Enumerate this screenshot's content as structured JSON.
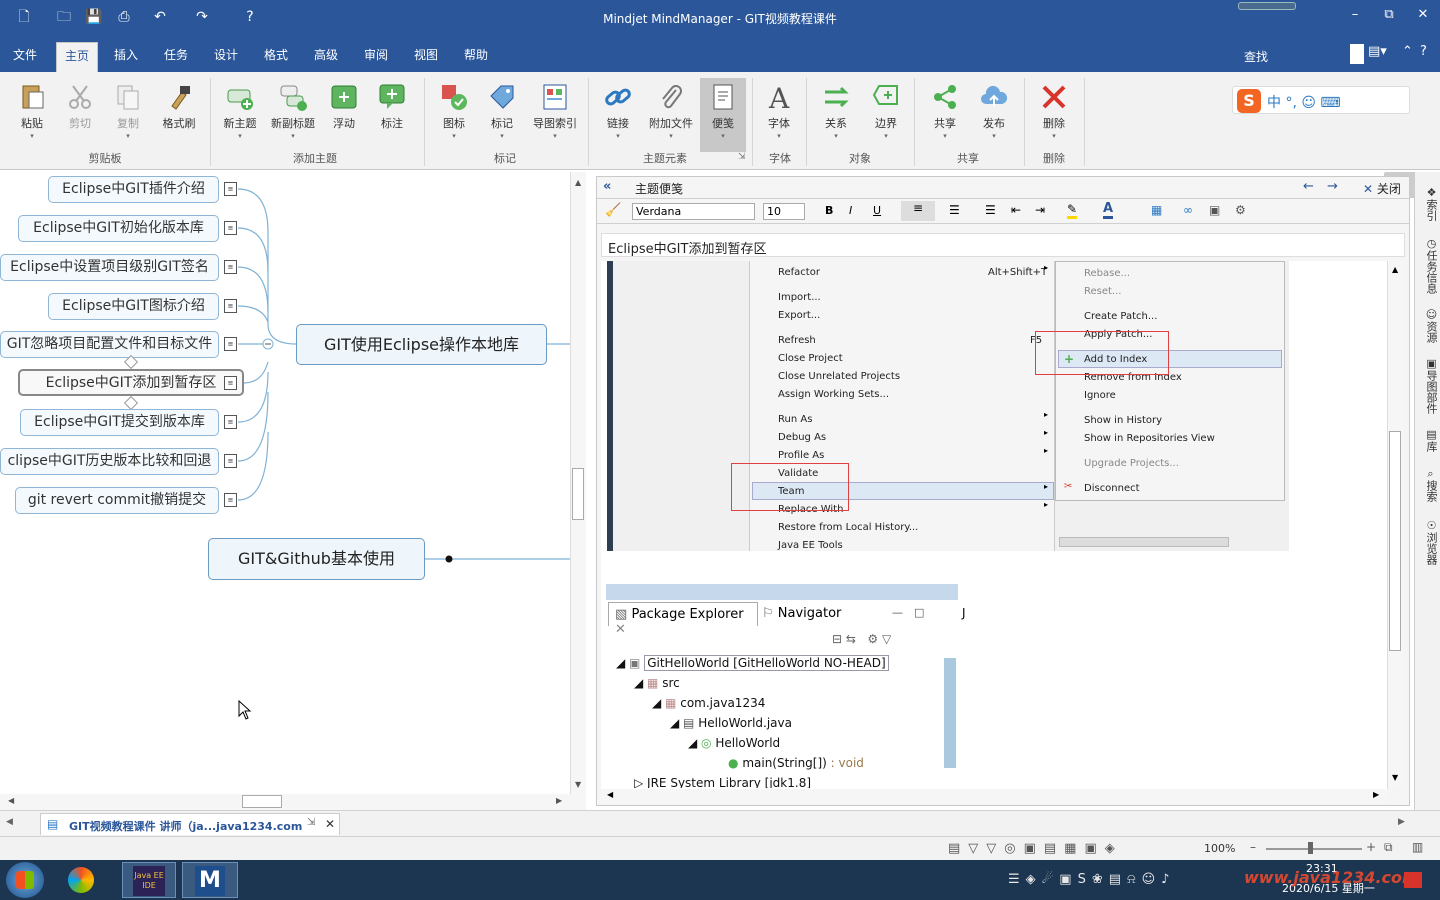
{
  "window": {
    "title": "Mindjet MindManager - GIT视频教程课件"
  },
  "tabs": [
    "文件",
    "主页",
    "插入",
    "任务",
    "设计",
    "格式",
    "高级",
    "审阅",
    "视图",
    "帮助"
  ],
  "active_tab": "主页",
  "search_label": "查找",
  "ribbon": {
    "buttons": [
      "粘贴",
      "剪切",
      "复制",
      "格式刷",
      "新主题",
      "新副标题",
      "浮动",
      "标注",
      "图标",
      "标记",
      "导图索引",
      "链接",
      "附加文件",
      "便笺",
      "字体",
      "关系",
      "边界",
      "共享",
      "发布",
      "删除"
    ],
    "groups": [
      "剪贴板",
      "添加主题",
      "标记",
      "主题元素",
      "字体",
      "对象",
      "共享",
      "删除"
    ]
  },
  "map": {
    "subtopics": [
      "Eclipse中GIT插件介绍",
      "Eclipse中GIT初始化版本库",
      "Eclipse中设置项目级别GIT签名",
      "Eclipse中GIT图标介绍",
      "GIT忽略项目配置文件和目标文件",
      "Eclipse中GIT添加到暂存区",
      "Eclipse中GIT提交到版本库",
      "clipse中GIT历史版本比较和回退",
      "git revert commit撤销提交"
    ],
    "main_topic": "GIT使用Eclipse操作本地库",
    "main_topic_2": "GIT&Github基本使用"
  },
  "notes_panel": {
    "title": "主题便笺",
    "close_label": "关闭",
    "font": "Verdana",
    "size": "10",
    "heading": "Eclipse中GIT添加到暂存区"
  },
  "context_menu": {
    "left": [
      {
        "label": "Refactor",
        "shortcut": "Alt+Shift+T",
        "arrow": true
      },
      {
        "label": "Import...",
        "shortcut": "",
        "arrow": false
      },
      {
        "label": "Export...",
        "shortcut": "",
        "arrow": false
      },
      {
        "label": "Refresh",
        "shortcut": "F5",
        "arrow": false
      },
      {
        "label": "Close Project",
        "shortcut": "",
        "arrow": false
      },
      {
        "label": "Close Unrelated Projects",
        "shortcut": "",
        "arrow": false
      },
      {
        "label": "Assign Working Sets...",
        "shortcut": "",
        "arrow": false
      },
      {
        "label": "Run As",
        "shortcut": "",
        "arrow": true
      },
      {
        "label": "Debug As",
        "shortcut": "",
        "arrow": true
      },
      {
        "label": "Profile As",
        "shortcut": "",
        "arrow": true
      },
      {
        "label": "Validate",
        "shortcut": "",
        "arrow": false
      },
      {
        "label": "Team",
        "shortcut": "",
        "arrow": true
      },
      {
        "label": "Replace With",
        "shortcut": "",
        "arrow": true
      },
      {
        "label": "Restore from Local History...",
        "shortcut": "",
        "arrow": false
      },
      {
        "label": "Java EE Tools",
        "shortcut": "",
        "arrow": true
      }
    ],
    "right": [
      {
        "label": "Rebase...",
        "disabled": true
      },
      {
        "label": "Reset...",
        "disabled": true
      },
      {
        "label": "Create Patch...",
        "disabled": false
      },
      {
        "label": "Apply Patch...",
        "disabled": false
      },
      {
        "label": "Add to Index",
        "disabled": false
      },
      {
        "label": "Remove from Index",
        "disabled": false
      },
      {
        "label": "Ignore",
        "disabled": false
      },
      {
        "label": "Show in History",
        "disabled": false
      },
      {
        "label": "Show in Repositories View",
        "disabled": false
      },
      {
        "label": "Upgrade Projects...",
        "disabled": true
      },
      {
        "label": "Disconnect",
        "disabled": false
      }
    ]
  },
  "explorer": {
    "tab1": "Package Explorer",
    "tab2": "Navigator",
    "tree": [
      {
        "label": "GitHelloWorld  [GitHelloWorld NO-HEAD]"
      },
      {
        "label": "src"
      },
      {
        "label": "com.java1234"
      },
      {
        "label": "HelloWorld.java"
      },
      {
        "label": "HelloWorld"
      },
      {
        "label": "main(String[])",
        "suffix": " : void"
      },
      {
        "label": "JRE System Library [jdk1.8]"
      }
    ]
  },
  "docbar": {
    "doc_tab": "GIT视频教程课件 讲师（ja...java1234.com"
  },
  "status": {
    "zoom": "100%"
  },
  "taskbar": {
    "time": "23:31",
    "date": "2020/6/15 星期一",
    "watermark": "www.java1234.com"
  },
  "right_panel": [
    "索引",
    "任务信息",
    "资源",
    "导图部件",
    "库",
    "搜索",
    "浏览器"
  ],
  "colors": {
    "accent": "#2b579a",
    "highlight": "#e04040"
  }
}
